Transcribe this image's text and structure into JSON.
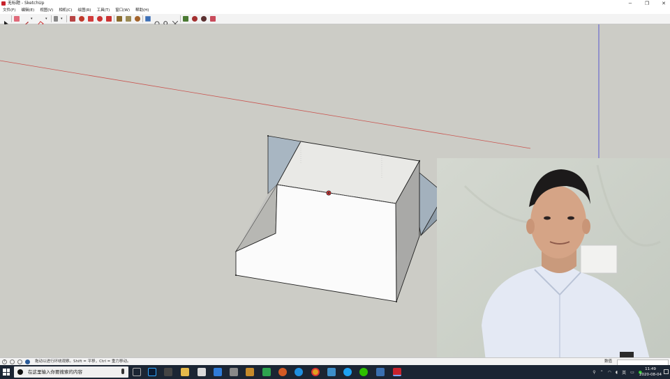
{
  "window": {
    "title": "无标题 - SketchUp",
    "controls": {
      "minimize": "−",
      "maximize": "❐",
      "close": "✕"
    }
  },
  "menubar": {
    "items": [
      "文件(F)",
      "编辑(E)",
      "视图(V)",
      "相机(C)",
      "绘图(R)",
      "工具(T)",
      "窗口(W)",
      "帮助(H)"
    ]
  },
  "toolbar": {
    "tools": [
      "select-tool",
      "eraser-tool",
      "line-tool",
      "line-dropdown",
      "shape-tool",
      "shape-dropdown",
      "rectangle-tool",
      "rect-dropdown",
      "push-pull-tool",
      "offset-tool",
      "move-tool",
      "rotate-tool",
      "scale-tool",
      "tape-measure-tool",
      "text-tool",
      "paint-bucket-tool",
      "orbit-tool",
      "pan-tool",
      "zoom-tool",
      "zoom-extents-tool",
      "warehouse-tool",
      "extension-tool",
      "layout-tool",
      "ruby-tool"
    ]
  },
  "colors": {
    "accent_red": "#c8232c",
    "axis_red": "#c9544f",
    "axis_blue": "#3a3ad0",
    "taskbar": "#1b2533"
  },
  "statusbar": {
    "hint": "拖动以进行环绕观察。Shift = 平移，Ctrl = 重力移动。",
    "vcb_label": "数值"
  },
  "taskbar": {
    "search_placeholder": "在这里输入你要搜索的内容",
    "time": "11:49",
    "date": "2020-08-04",
    "apps": [
      "task-view",
      "photoshop",
      "steam",
      "file-explorer",
      "notepad",
      "mail",
      "camera",
      "media",
      "green-app",
      "red-app",
      "edge",
      "chrome",
      "store",
      "qq",
      "wechat",
      "photos",
      "sketchup"
    ]
  }
}
